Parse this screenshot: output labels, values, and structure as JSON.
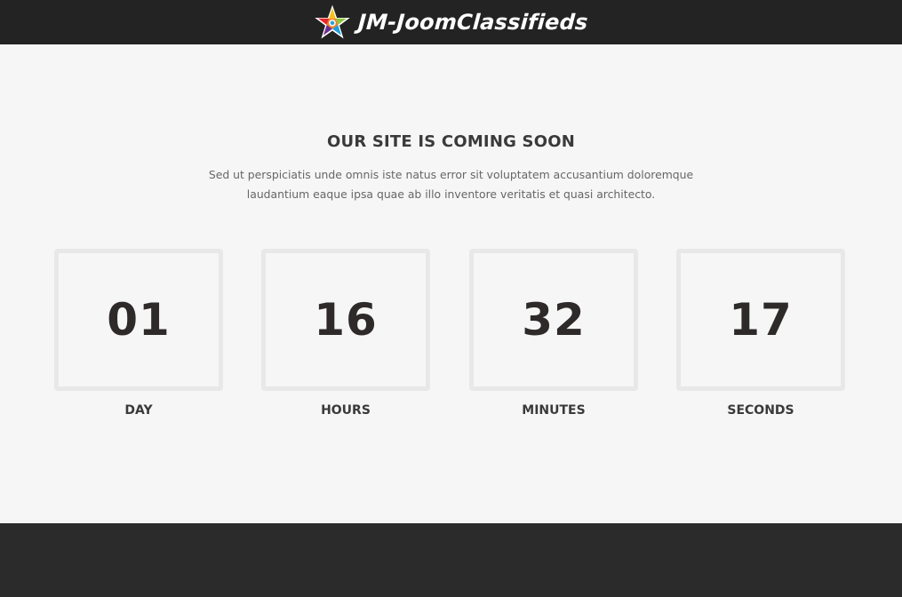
{
  "header": {
    "brand_name": "JM-JoomClassifieds",
    "logo_icon": "multicolor-star-icon"
  },
  "hero": {
    "title": "OUR SITE IS COMING SOON",
    "description": "Sed ut perspiciatis unde omnis iste natus error sit voluptatem accusantium doloremque laudantium eaque ipsa quae ab illo inventore veritatis et quasi architecto."
  },
  "countdown": [
    {
      "value": "01",
      "label": "DAY"
    },
    {
      "value": "16",
      "label": "HOURS"
    },
    {
      "value": "32",
      "label": "MINUTES"
    },
    {
      "value": "17",
      "label": "SECONDS"
    }
  ],
  "colors": {
    "header_bg": "#232323",
    "page_bg": "#f6f6f6",
    "footer_bg": "#2b2b2b",
    "box_border": "#e8e8e8",
    "number_text": "#2e2a2a"
  }
}
